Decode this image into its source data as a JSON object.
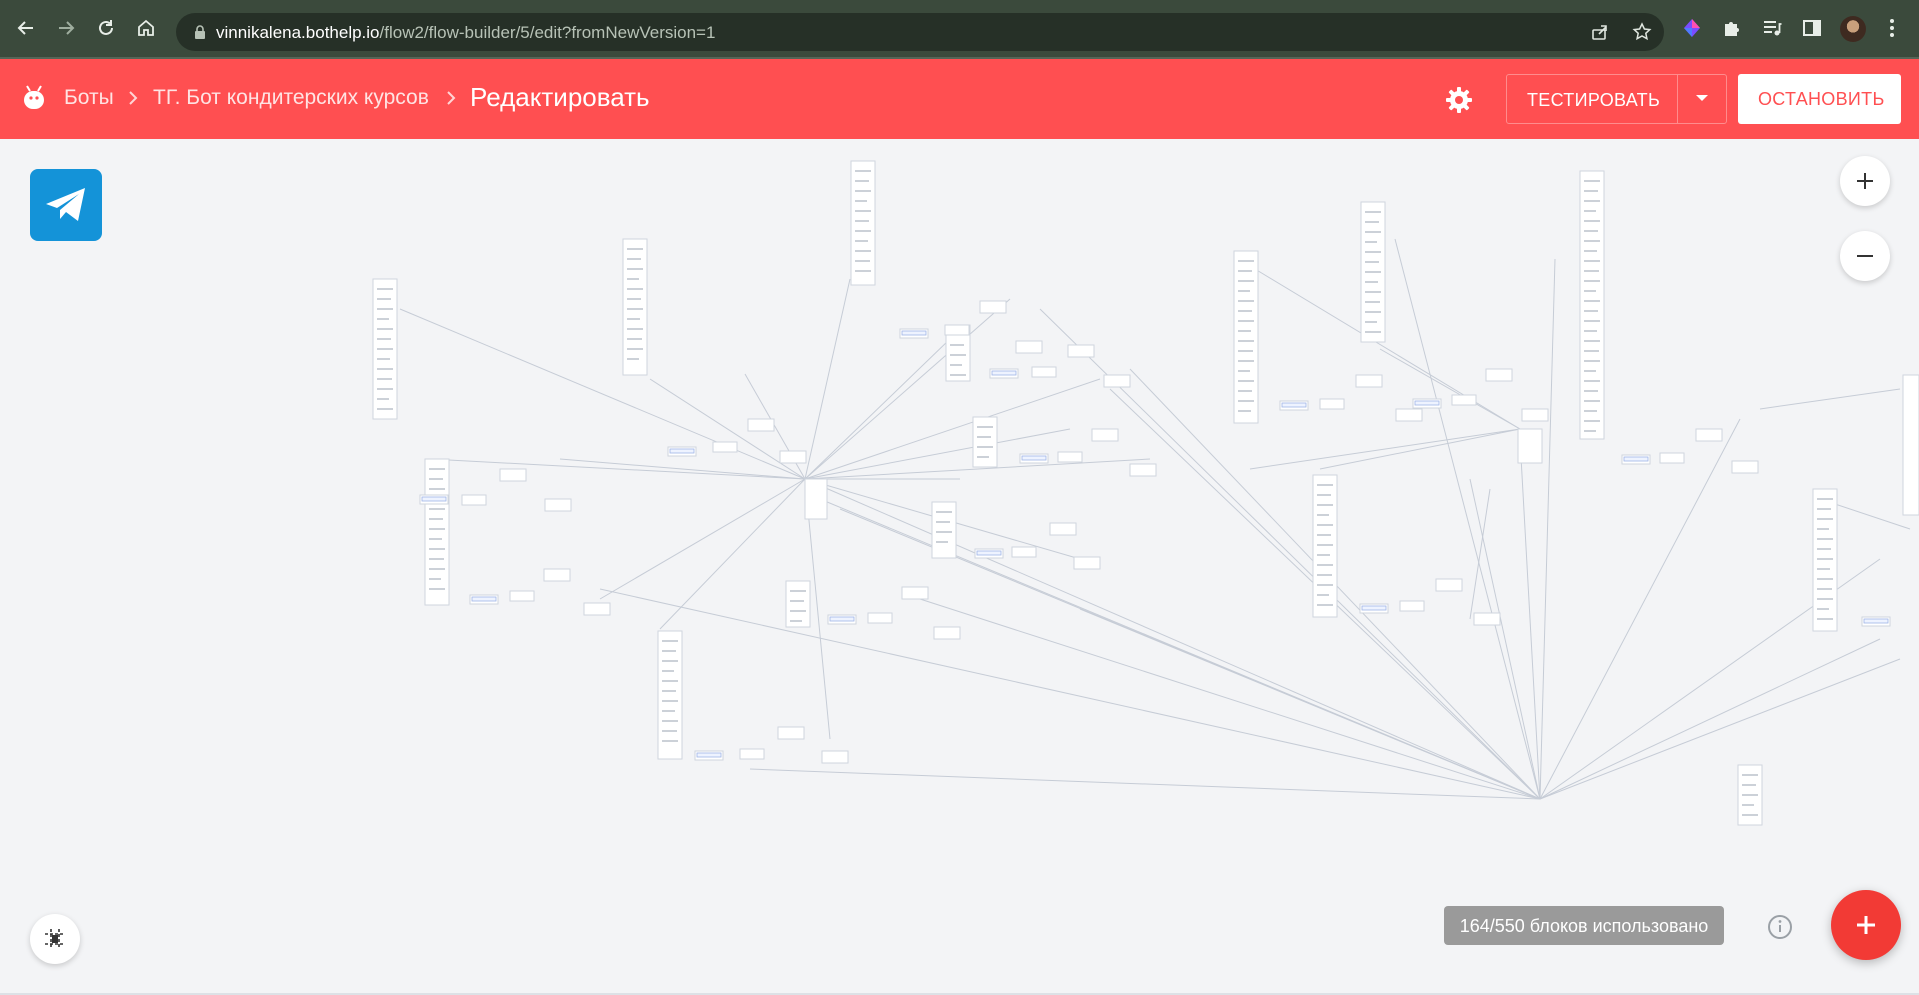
{
  "browser": {
    "url_host": "vinnikalena.bothelp.io",
    "url_path": "/flow2/flow-builder/5/edit?fromNewVersion=1",
    "icons": {
      "back": "arrow-left-icon",
      "forward": "arrow-right-icon",
      "reload": "reload-icon",
      "home": "home-icon",
      "lock": "lock-icon",
      "share": "share-icon",
      "bookmark": "star-icon",
      "extensions": [
        "colorful-extension-icon",
        "puzzle-icon",
        "media-list-icon",
        "side-panel-icon"
      ],
      "menu": "kebab-menu-icon"
    }
  },
  "header": {
    "bg_color": "#ff4f51",
    "breadcrumbs": [
      "Боты",
      "ТГ. Бот кондитерских курсов"
    ],
    "current": "Редактировать",
    "test_label": "ТЕСТИРОВАТЬ",
    "stop_label": "ОСТАНОВИТЬ"
  },
  "canvas": {
    "channel": "telegram",
    "usage_text": "164/550 блоков использовано",
    "fab_color": "#f23a35"
  }
}
